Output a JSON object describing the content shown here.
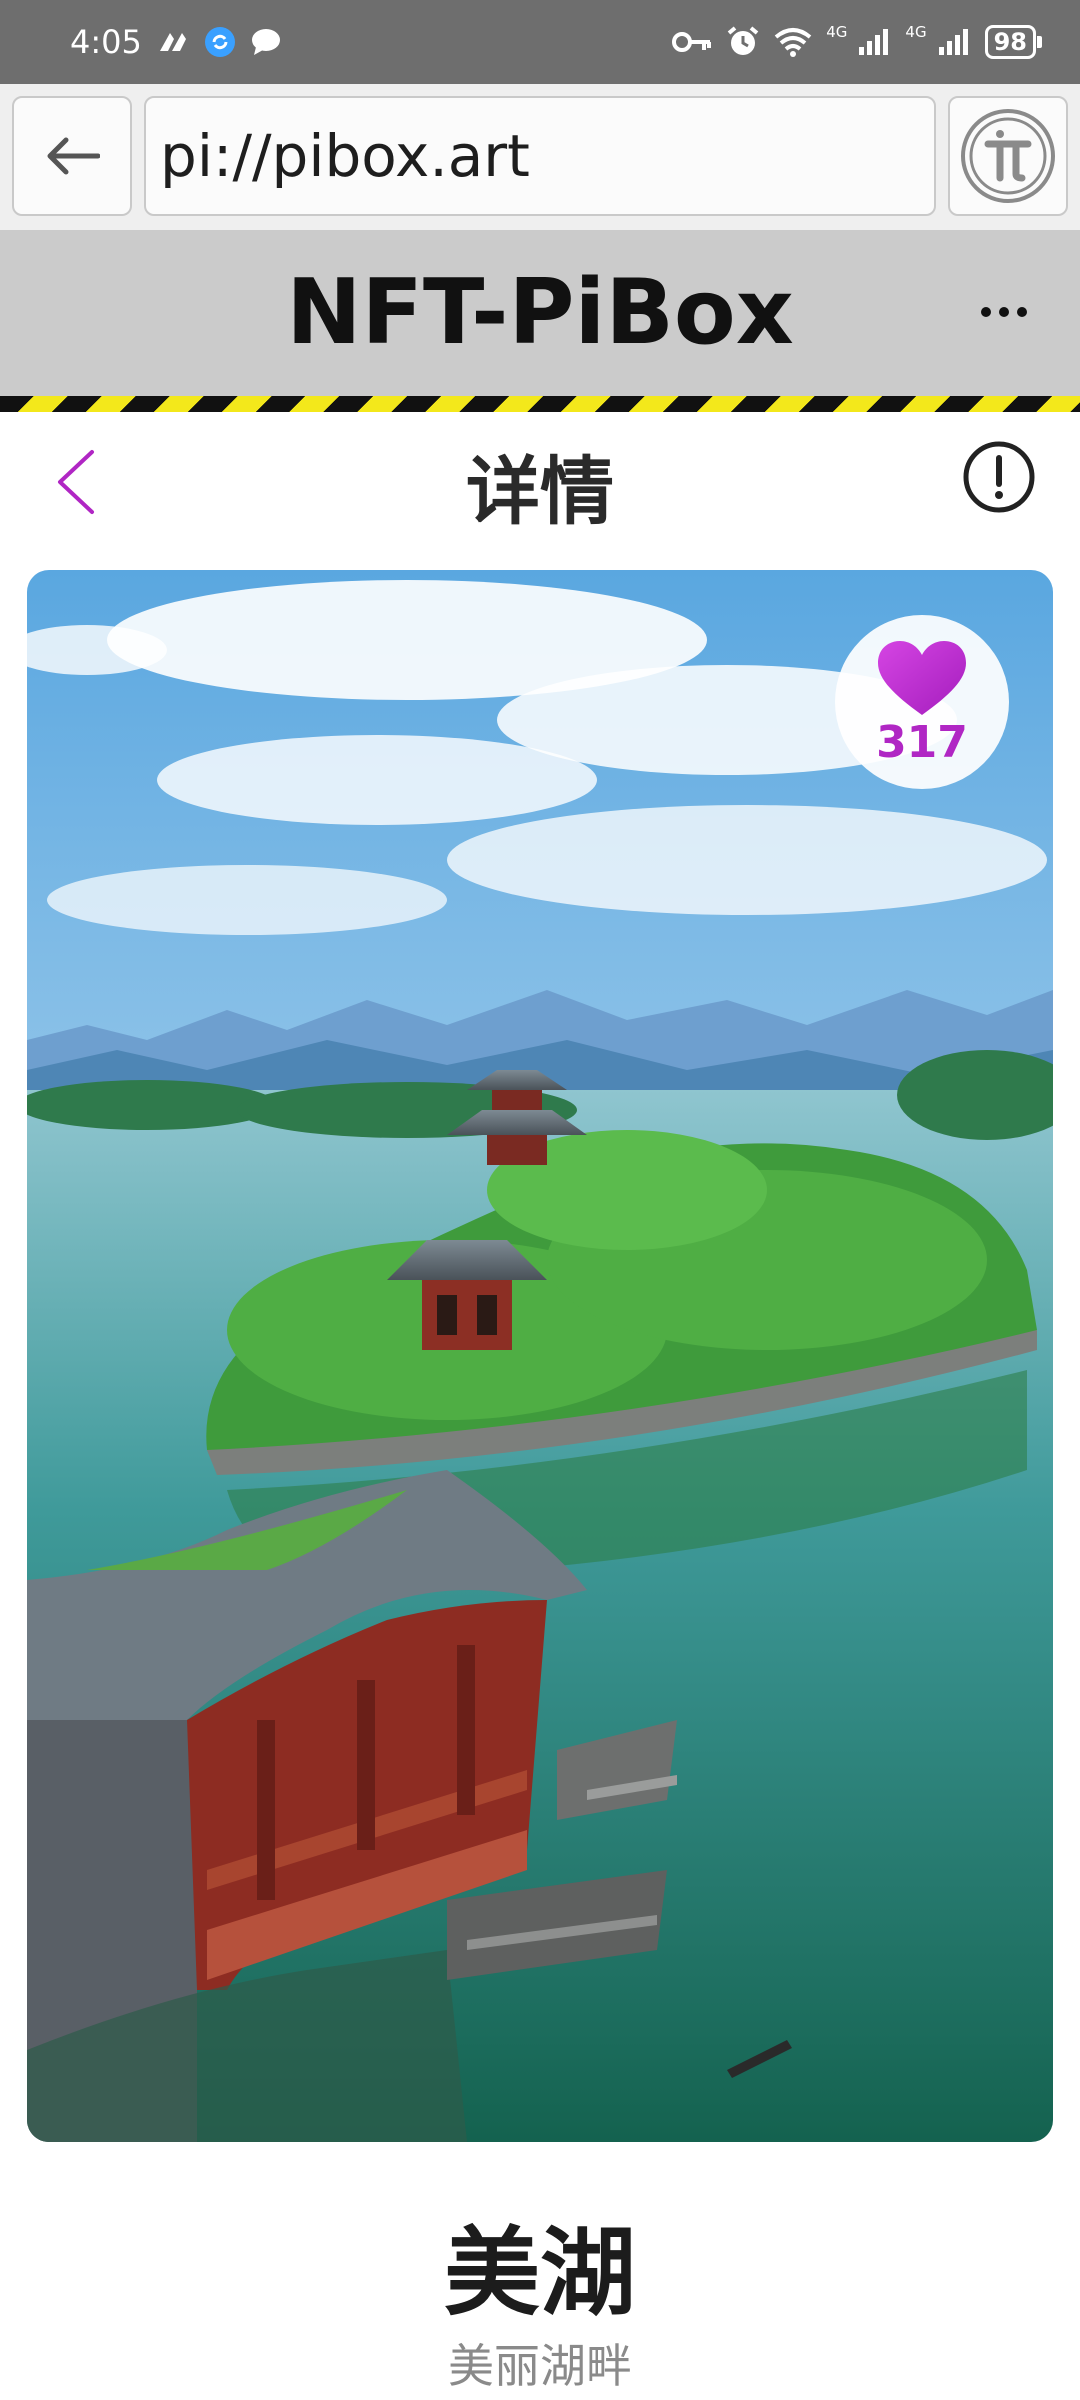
{
  "status_bar": {
    "time": "4:05",
    "net_label_1": "4G",
    "net_label_2": "4G",
    "battery": "98"
  },
  "browser": {
    "url": "pi://pibox.art"
  },
  "app": {
    "title": "NFT-PiBox"
  },
  "page": {
    "title": "详情"
  },
  "artwork": {
    "like_count": "317",
    "accent_color": "#b026c4"
  },
  "nft": {
    "title": "美湖",
    "subtitle": "美丽湖畔"
  }
}
